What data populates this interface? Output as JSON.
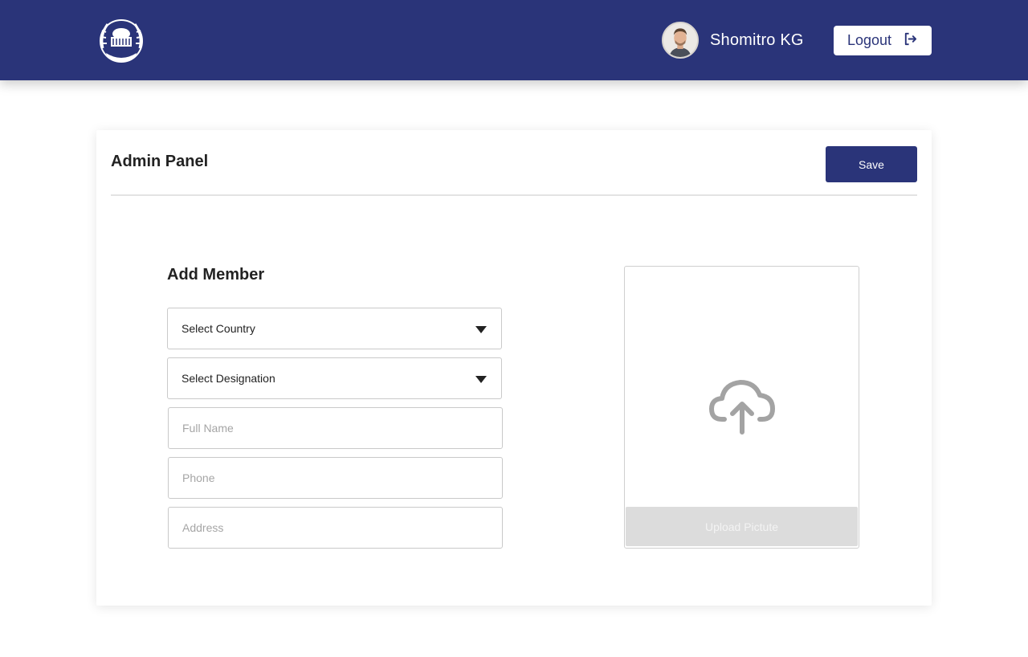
{
  "header": {
    "user_name": "Shomitro KG",
    "logout_label": "Logout"
  },
  "panel": {
    "title": "Admin Panel",
    "save_label": "Save"
  },
  "form": {
    "title": "Add Member",
    "country_select": "Select Country",
    "designation_select": "Select Designation",
    "full_name_placeholder": "Full Name",
    "phone_placeholder": "Phone",
    "address_placeholder": "Address",
    "upload_label": "Upload Pictute"
  },
  "icons": {
    "logo": "organization-emblem",
    "avatar": "user-avatar",
    "logout": "logout-icon",
    "dropdown": "caret-down-icon",
    "upload": "cloud-upload-icon"
  },
  "colors": {
    "brand": "#2a3479",
    "upload_button": "#dcdcdc"
  }
}
